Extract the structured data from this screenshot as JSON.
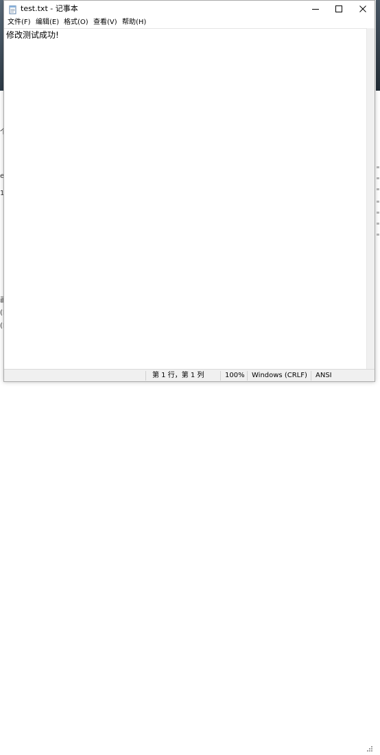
{
  "window": {
    "title": "test.txt - 记事本",
    "file_icon": "notepad-file-icon"
  },
  "caption": {
    "minimize_icon": "minimize-icon",
    "maximize_icon": "maximize-icon",
    "close_icon": "close-icon"
  },
  "menu": {
    "items": [
      {
        "label": "文件(F)"
      },
      {
        "label": "编辑(E)"
      },
      {
        "label": "格式(O)"
      },
      {
        "label": "查看(V)"
      },
      {
        "label": "帮助(H)"
      }
    ]
  },
  "editor": {
    "content": "修改测试成功!"
  },
  "status": {
    "position": "第 1 行，第 1 列",
    "zoom": "100%",
    "line_ending": "Windows (CRLF)",
    "encoding": "ANSI"
  },
  "background": {
    "glyphs": [
      "个",
      "e",
      "1",
      "画",
      "(I",
      "(I"
    ]
  }
}
